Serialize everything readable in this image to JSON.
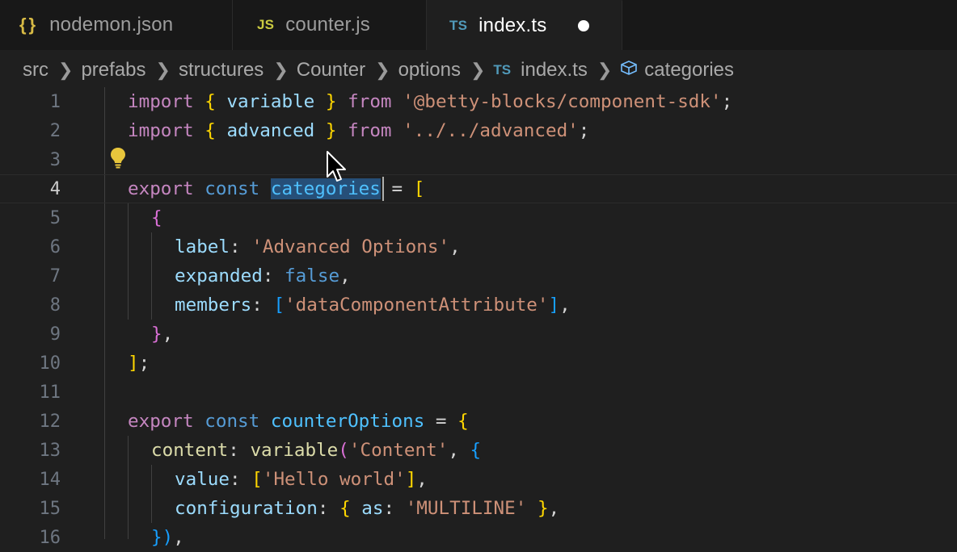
{
  "tabs": [
    {
      "icon": "{}",
      "label": "nodemon.json"
    },
    {
      "icon": "JS",
      "label": "counter.js"
    },
    {
      "icon": "TS",
      "label": "index.ts"
    }
  ],
  "breadcrumb": [
    "src",
    "prefabs",
    "structures",
    "Counter",
    "options",
    "index.ts",
    "categories"
  ],
  "breadcrumb_ts_icon": "TS",
  "line_numbers": [
    "1",
    "2",
    "3",
    "4",
    "5",
    "6",
    "7",
    "8",
    "9",
    "10",
    "11",
    "12",
    "13",
    "14",
    "15",
    "16"
  ],
  "code": {
    "l1": {
      "kw": "import",
      "ob": "{",
      "id": "variable",
      "cb": "}",
      "from": "from",
      "str": "'@betty-blocks/component-sdk'",
      "semi": ";"
    },
    "l2": {
      "kw": "import",
      "ob": "{",
      "id": "advanced",
      "cb": "}",
      "from": "from",
      "str": "'../../advanced'",
      "semi": ";"
    },
    "l4": {
      "kw": "export",
      "kw2": "const",
      "sel": "categories",
      "eq": " = ",
      "br": "["
    },
    "l5": {
      "br": "{"
    },
    "l6": {
      "prop": "label",
      "colon": ": ",
      "str": "'Advanced Options'",
      "comma": ","
    },
    "l7": {
      "prop": "expanded",
      "colon": ": ",
      "val": "false",
      "comma": ","
    },
    "l8": {
      "prop": "members",
      "colon": ": ",
      "ob": "[",
      "str": "'dataComponentAttribute'",
      "cb": "]",
      "comma": ","
    },
    "l9": {
      "br": "}",
      "comma": ","
    },
    "l10": {
      "br": "]",
      "semi": ";"
    },
    "l12": {
      "kw": "export",
      "kw2": "const",
      "id": "counterOptions",
      "eq": " = ",
      "br": "{"
    },
    "l13": {
      "prop": "content",
      "colon": ": ",
      "fn": "variable",
      "op": "(",
      "str": "'Content'",
      "comma": ", ",
      "br": "{"
    },
    "l14": {
      "prop": "value",
      "colon": ": ",
      "ob": "[",
      "str": "'Hello world'",
      "cb": "]",
      "comma": ","
    },
    "l15": {
      "prop": "configuration",
      "colon": ": ",
      "ob": "{",
      "as": " as",
      "colon2": ": ",
      "str": "'MULTILINE'",
      "cb": " }",
      "comma": ","
    },
    "l16": {
      "br": "})",
      "comma": ","
    }
  },
  "colors": {
    "keyword": "#c586c0",
    "storage": "#569cd6",
    "variable": "#9cdcfe",
    "string": "#ce9178",
    "function": "#dcdcaa",
    "bracket_gold": "#ffd700",
    "bracket_pink": "#da70d6",
    "bracket_blue": "#179fff",
    "selection": "#264f78"
  }
}
